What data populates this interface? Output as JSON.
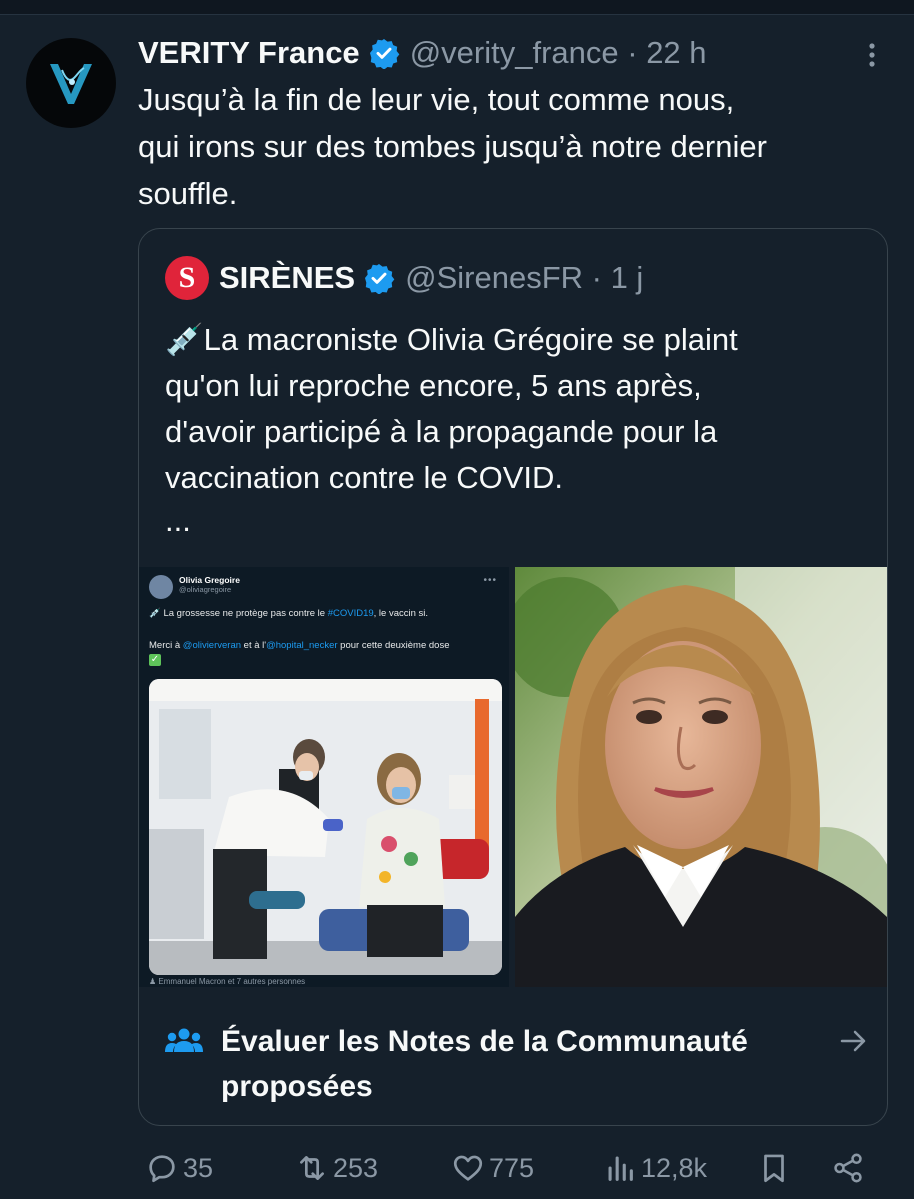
{
  "tweet": {
    "author_name": "VERITY France",
    "handle": "@verity_france",
    "time": "22 h",
    "lines": [
      "Jusqu’à la fin de leur vie, tout comme nous,",
      "qui irons sur des tombes jusqu’à notre dernier",
      "souffle."
    ]
  },
  "quote": {
    "logo_letter": "S",
    "author_name": "SIRÈNES",
    "handle": "@SirenesFR",
    "time": "1 j",
    "lines": [
      "💉La macroniste Olivia Grégoire se plaint",
      "qu'on lui reproche encore, 5 ans après,",
      "d'avoir participé à la propagande pour la",
      "vaccination contre le COVID."
    ],
    "ellipsis": "..."
  },
  "embedded_post": {
    "name": "Olivia Gregoire",
    "handle": "@oliviagregoire",
    "text_before": "💉 La grossesse ne protège pas contre le ",
    "hashtag": "#COVID19",
    "text_after": ", le vaccin si.",
    "line2_a": "Merci à ",
    "mention1": "@olivierveran",
    "line2_b": " et à l'",
    "mention2": "@hopital_necker",
    "line2_c": " pour cette deuxième dose",
    "check": "✓",
    "caption": "Emmanuel Macron et 7 autres personnes"
  },
  "notes": {
    "label": "Évaluer les Notes de la Communauté proposées"
  },
  "actions": {
    "replies": "35",
    "reposts": "253",
    "likes": "775",
    "views": "12,8k"
  },
  "colors": {
    "background": "#15202b",
    "accent": "#1d9bf0",
    "muted": "#8b98a5",
    "border": "#38444d"
  }
}
